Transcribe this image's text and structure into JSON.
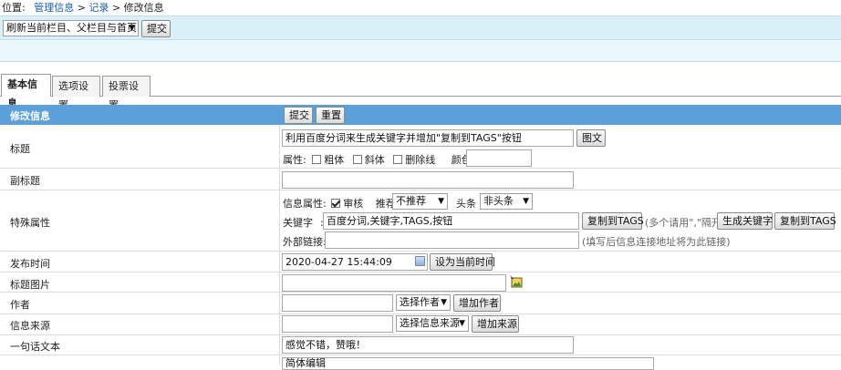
{
  "breadcrumb": {
    "prefix": "位置:",
    "item1": "管理信息",
    "sep1": ">",
    "item2": "记录",
    "sep2": ">",
    "current": "修改信息"
  },
  "toolbar": {
    "refresh_select": "刷新当前栏目、父栏目与首页",
    "submit": "提交"
  },
  "tabs": [
    "基本信息",
    "选项设置",
    "投票设置"
  ],
  "header": {
    "title": "修改信息",
    "submit": "提交",
    "reset": "重置"
  },
  "fields": {
    "title": {
      "label": "标题",
      "value": "利用百度分词来生成关键字并增加\"复制到TAGS\"按钮",
      "image_button": "图文",
      "attr_label": "属性:",
      "bold": "粗体",
      "italic": "斜体",
      "strike": "删除线",
      "color_label": "颜色:"
    },
    "subtitle": {
      "label": "副标题"
    },
    "special": {
      "label": "特殊属性",
      "info_attr_label": "信息属性:",
      "review": "审核",
      "recommend_label": "推荐",
      "recommend_value": "不推荐",
      "headline_label": "头条",
      "headline_value": "非头条",
      "keyword_label": "关键字",
      "keyword_colon": ":",
      "keyword_value": "百度分词,关键字,TAGS,按钮",
      "copy_tags": "复制到TAGS",
      "keyword_hint": "(多个请用\",\"隔开)",
      "gen_keywords": "生成关键字",
      "copy_tags2": "复制到TAGS",
      "external_label": "外部链接:",
      "external_hint": "(填写后信息连接地址将为此链接)"
    },
    "publish_time": {
      "label": "发布时间",
      "value": "2020-04-27 15:44:09",
      "set_now": "设为当前时间"
    },
    "title_image": {
      "label": "标题图片"
    },
    "author": {
      "label": "作者",
      "select": "选择作者",
      "add": "增加作者"
    },
    "source": {
      "label": "信息来源",
      "select": "选择信息来源",
      "add": "增加来源"
    },
    "summary": {
      "label": "一句话文本",
      "value": "感觉不错，赞哦！"
    },
    "bottom_value": "简体编辑"
  },
  "colors": {
    "header_bar": "#5ba0d8",
    "toolbar_bg": "#daf0f9",
    "link": "#1a5cb4"
  }
}
